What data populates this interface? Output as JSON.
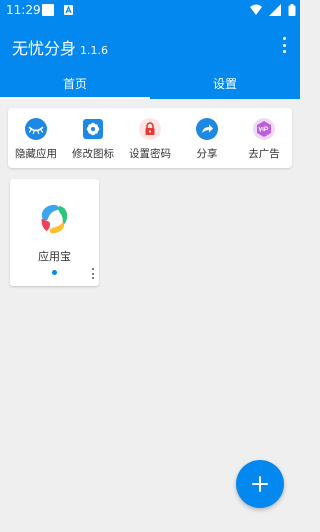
{
  "status_bar": {
    "time": "11:29"
  },
  "app": {
    "title": "无忧分身",
    "version": "1.1.6"
  },
  "tabs": [
    {
      "label": "首页",
      "selected": true
    },
    {
      "label": "设置",
      "selected": false
    }
  ],
  "actions": [
    {
      "label": "隐藏应用",
      "icon": "eye-closed-icon",
      "color": "#1e88e5"
    },
    {
      "label": "修改图标",
      "icon": "flower-icon",
      "color": "#1e88e5"
    },
    {
      "label": "设置密码",
      "icon": "lock-icon",
      "color": "#e53935"
    },
    {
      "label": "分享",
      "icon": "share-arrow-icon",
      "color": "#1e88e5"
    },
    {
      "label": "去广告",
      "icon": "vip-icon",
      "color": "#c05ce0"
    }
  ],
  "apps": [
    {
      "name": "应用宝",
      "icon": "yingyongbao-icon",
      "active": true
    }
  ],
  "colors": {
    "primary": "#0288ee",
    "background": "#efefef"
  },
  "fab": {
    "icon": "plus-icon"
  }
}
